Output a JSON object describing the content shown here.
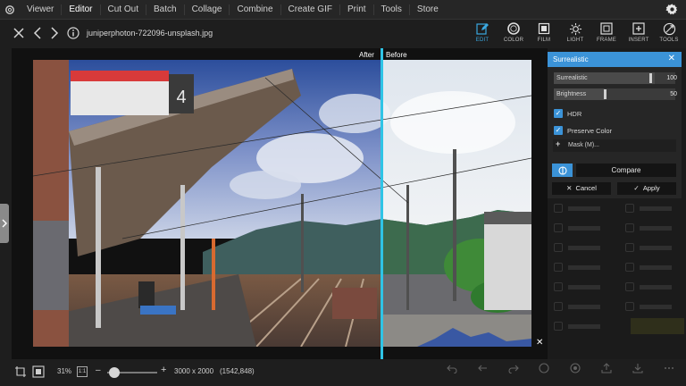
{
  "menu": {
    "items": [
      "Viewer",
      "Editor",
      "Cut Out",
      "Batch",
      "Collage",
      "Combine",
      "Create GIF",
      "Print",
      "Tools",
      "Store"
    ],
    "active": "Editor"
  },
  "file": {
    "name": "juniperphoton-722096-unsplash.jpg"
  },
  "tools": [
    {
      "label": "EDIT",
      "icon": "edit-icon"
    },
    {
      "label": "COLOR",
      "icon": "color-icon"
    },
    {
      "label": "FILM",
      "icon": "film-icon"
    },
    {
      "label": "LIGHT",
      "icon": "light-icon"
    },
    {
      "label": "FRAME",
      "icon": "frame-icon"
    },
    {
      "label": "INSERT",
      "icon": "insert-icon"
    },
    {
      "label": "TOOLS",
      "icon": "tools-icon"
    }
  ],
  "compare": {
    "after_label": "After",
    "before_label": "Before"
  },
  "panel": {
    "title": "Surrealistic",
    "sliders": [
      {
        "name": "Surrealistic",
        "value": "100",
        "fraction": 1.0
      },
      {
        "name": "Brightness",
        "value": "50",
        "fraction": 0.5
      }
    ],
    "checks": [
      {
        "label": "HDR",
        "checked": true
      },
      {
        "label": "Preserve Color",
        "checked": true
      }
    ],
    "mask_label": "Mask (M)...",
    "compare_button": "Compare",
    "cancel_button": "Cancel",
    "apply_button": "Apply"
  },
  "status": {
    "zoom": "31%",
    "ratio_label": "1:1",
    "dimensions": "3000 x 2000",
    "pixels": "(1542,848)"
  },
  "colors": {
    "accent": "#3b93d8",
    "split_line": "#2fc4e6"
  }
}
